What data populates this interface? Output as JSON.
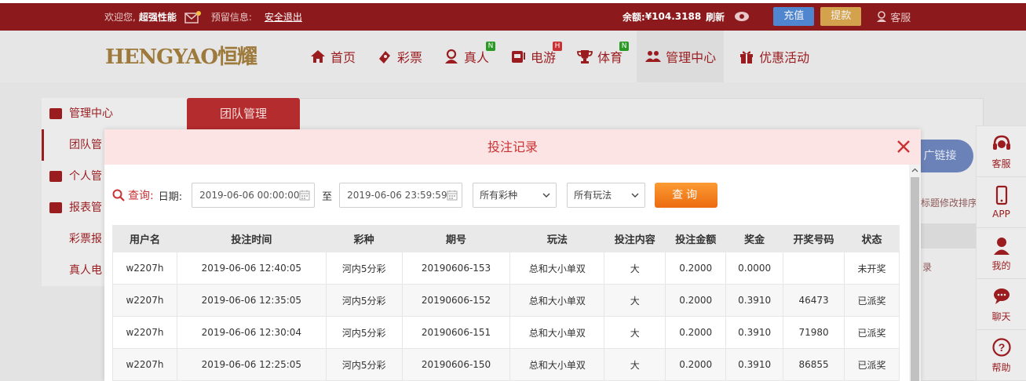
{
  "topbar": {
    "welcome": "欢迎您,",
    "username": "超强性能",
    "alert_label": "预留信息:",
    "logout": "安全退出",
    "balance_label": "余额:",
    "balance_value": "¥104.3188",
    "refresh": "刷新",
    "deposit": "充值",
    "withdraw": "提款",
    "service": "客服"
  },
  "logo": {
    "text": "HENGYAO恒耀"
  },
  "nav": {
    "items": [
      {
        "label": "首页",
        "icon": "home-icon",
        "badge": ""
      },
      {
        "label": "彩票",
        "icon": "lottery-icon",
        "badge": ""
      },
      {
        "label": "真人",
        "icon": "live-icon",
        "badge": "N"
      },
      {
        "label": "电游",
        "icon": "slot-icon",
        "badge": "H"
      },
      {
        "label": "体育",
        "icon": "trophy-icon",
        "badge": "N"
      },
      {
        "label": "管理中心",
        "icon": "users-icon",
        "badge": ""
      },
      {
        "label": "优惠活动",
        "icon": "gift-icon",
        "badge": ""
      }
    ]
  },
  "sidebar": {
    "items": [
      {
        "label": "管理中心"
      },
      {
        "label": "团队管"
      },
      {
        "label": "个人管"
      },
      {
        "label": "报表管"
      },
      {
        "label": "彩票报"
      },
      {
        "label": "真人电"
      }
    ]
  },
  "panel": {
    "tab": "团队管理",
    "ext_link": "广链接",
    "ext_sort": "标题修改排序",
    "ext_rec": "录"
  },
  "rightbar": {
    "items": [
      {
        "label": "客服",
        "icon": "headset-icon"
      },
      {
        "label": "APP",
        "icon": "phone-icon"
      },
      {
        "label": "我的",
        "icon": "user-icon"
      },
      {
        "label": "聊天",
        "icon": "chat-icon"
      },
      {
        "label": "帮助",
        "icon": "help-icon"
      }
    ]
  },
  "modal": {
    "title": "投注记录",
    "query_label": "查询:",
    "date_label": "日期:",
    "date_from": "2019-06-06 00:00:00",
    "date_to": "2019-06-06 23:59:59",
    "to": "至",
    "lottery_select": "所有彩种",
    "play_select": "所有玩法",
    "query_button": "查询",
    "columns": [
      "用户名",
      "投注时间",
      "彩种",
      "期号",
      "玩法",
      "投注内容",
      "投注金额",
      "奖金",
      "开奖号码",
      "状态"
    ],
    "rows": [
      {
        "user": "w2207h",
        "time": "2019-06-06 12:40:05",
        "lottery": "河内5分彩",
        "issue": "20190606-153",
        "play": "总和大小单双",
        "content": "大",
        "amount": "0.2000",
        "prize": "0.0000",
        "number": "",
        "status": "未开奖",
        "status_type": "pending"
      },
      {
        "user": "w2207h",
        "time": "2019-06-06 12:35:05",
        "lottery": "河内5分彩",
        "issue": "20190606-152",
        "play": "总和大小单双",
        "content": "大",
        "amount": "0.2000",
        "prize": "0.3910",
        "number": "46473",
        "status": "已派奖",
        "status_type": "paid"
      },
      {
        "user": "w2207h",
        "time": "2019-06-06 12:30:04",
        "lottery": "河内5分彩",
        "issue": "20190606-151",
        "play": "总和大小单双",
        "content": "大",
        "amount": "0.2000",
        "prize": "0.3910",
        "number": "71980",
        "status": "已派奖",
        "status_type": "paid"
      },
      {
        "user": "w2207h",
        "time": "2019-06-06 12:25:05",
        "lottery": "河内5分彩",
        "issue": "20190606-150",
        "play": "总和大小单双",
        "content": "大",
        "amount": "0.2000",
        "prize": "0.3910",
        "number": "86855",
        "status": "已派奖",
        "status_type": "paid"
      }
    ]
  }
}
